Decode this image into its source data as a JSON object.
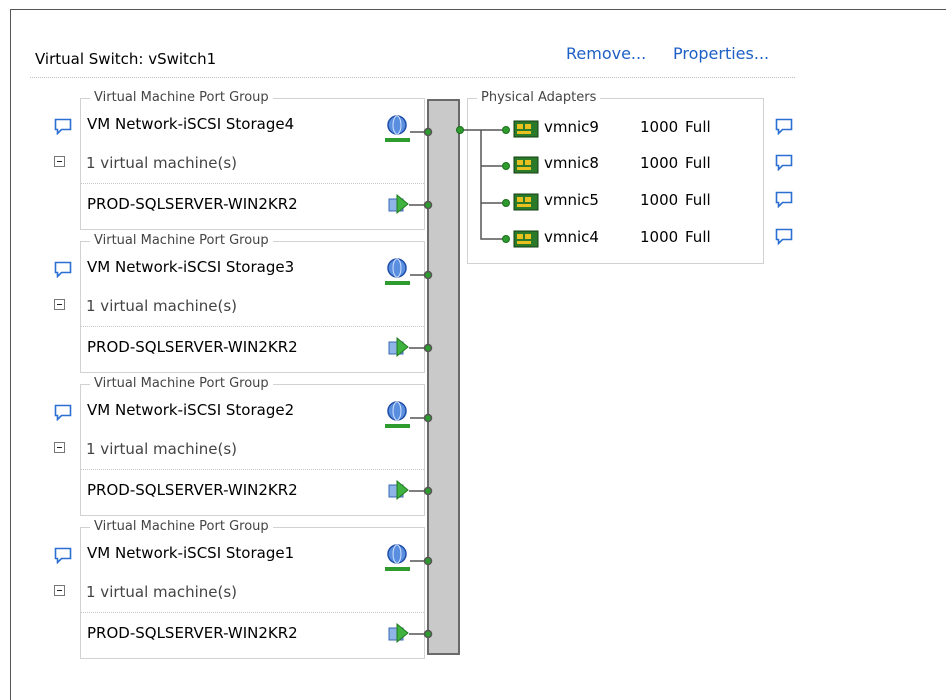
{
  "switch": {
    "title": "Virtual Switch: vSwitch1",
    "remove_label": "Remove...",
    "properties_label": "Properties..."
  },
  "port_groups": [
    {
      "legend": "Virtual Machine Port Group",
      "name": "VM Network-iSCSI Storage4",
      "vm_count": "1 virtual machine(s)",
      "vm": "PROD-SQLSERVER-WIN2KR2"
    },
    {
      "legend": "Virtual Machine Port Group",
      "name": "VM Network-iSCSI Storage3",
      "vm_count": "1 virtual machine(s)",
      "vm": "PROD-SQLSERVER-WIN2KR2"
    },
    {
      "legend": "Virtual Machine Port Group",
      "name": "VM Network-iSCSI Storage2",
      "vm_count": "1 virtual machine(s)",
      "vm": "PROD-SQLSERVER-WIN2KR2"
    },
    {
      "legend": "Virtual Machine Port Group",
      "name": "VM Network-iSCSI Storage1",
      "vm_count": "1 virtual machine(s)",
      "vm": "PROD-SQLSERVER-WIN2KR2"
    }
  ],
  "physical_adapters": {
    "legend": "Physical Adapters",
    "nics": [
      {
        "name": "vmnic9",
        "speed": "1000",
        "duplex": "Full"
      },
      {
        "name": "vmnic8",
        "speed": "1000",
        "duplex": "Full"
      },
      {
        "name": "vmnic5",
        "speed": "1000",
        "duplex": "Full"
      },
      {
        "name": "vmnic4",
        "speed": "1000",
        "duplex": "Full"
      }
    ]
  },
  "colors": {
    "link": "#1e5fc6",
    "connector_green": "#2e9b2e",
    "switch_gray": "#c9c9c9"
  },
  "icons": {
    "comment": "speech-bubble-icon",
    "network": "network-globe-icon",
    "vm": "virtual-machine-icon",
    "nic": "network-card-icon",
    "collapse": "collapse-minus-icon"
  }
}
